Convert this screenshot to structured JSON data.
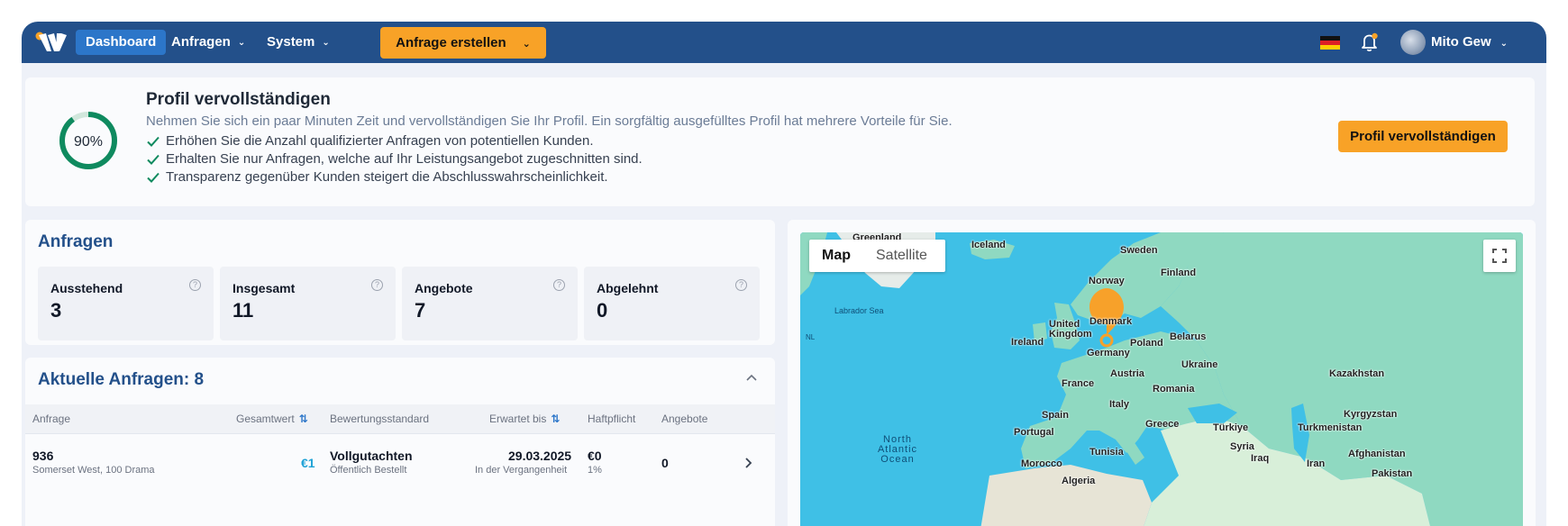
{
  "nav": {
    "dashboard": "Dashboard",
    "anfragen": "Anfragen",
    "system": "System",
    "cta": "Anfrage erstellen",
    "user": "Mito Gew"
  },
  "profile": {
    "percent": "90%",
    "progress": 0.9,
    "title": "Profil vervollständigen",
    "subtitle": "Nehmen Sie sich ein paar Minuten Zeit und vervollständigen Sie Ihr Profil. Ein sorgfältig ausgefülltes Profil hat mehrere Vorteile für Sie.",
    "bullets": [
      "Erhöhen Sie die Anzahl qualifizierter Anfragen von potentiellen Kunden.",
      "Erhalten Sie nur Anfragen, welche auf Ihr Leistungsangebot zugeschnitten sind.",
      "Transparenz gegenüber Kunden steigert die Abschlusswahrscheinlichkeit."
    ],
    "button": "Profil vervollständigen"
  },
  "stats": {
    "title": "Anfragen",
    "items": [
      {
        "label": "Ausstehend",
        "value": "3"
      },
      {
        "label": "Insgesamt",
        "value": "11"
      },
      {
        "label": "Angebote",
        "value": "7"
      },
      {
        "label": "Abgelehnt",
        "value": "0"
      }
    ]
  },
  "table": {
    "title": "Aktuelle Anfragen: 8",
    "headers": {
      "anfrage": "Anfrage",
      "gesamtwert": "Gesamtwert",
      "standard": "Bewertungsstandard",
      "erwartet": "Erwartet bis",
      "haftpflicht": "Haftpflicht",
      "angebote": "Angebote"
    },
    "rows": [
      {
        "id": "936",
        "address": "Somerset West, 100 Drama",
        "value": "€1",
        "standard": "Vollgutachten",
        "standard_sub": "Öffentlich Bestellt",
        "date": "29.03.2025",
        "date_sub": "In der Vergangenheit",
        "liability": "€0",
        "liability_sub": "1%",
        "offers": "0"
      }
    ]
  },
  "map": {
    "map_label": "Map",
    "satellite_label": "Satellite",
    "labels": {
      "greenland": "Greenland",
      "iceland": "Iceland",
      "sweden": "Sweden",
      "finland": "Finland",
      "norway": "Norway",
      "labrador": "Labrador Sea",
      "nl": "NL",
      "uk": "United Kingdom",
      "denmark": "Denmark",
      "ireland": "Ireland",
      "poland": "Poland",
      "belarus": "Belarus",
      "germany": "Germany",
      "ukraine": "Ukraine",
      "austria": "Austria",
      "france": "France",
      "romania": "Romania",
      "kazakhstan": "Kazakhstan",
      "italy": "Italy",
      "spain": "Spain",
      "kyrgyzstan": "Kyrgyzstan",
      "portugal": "Portugal",
      "greece": "Greece",
      "turkiye": "Türkiye",
      "turkmenistan": "Turkmenistan",
      "ocean": "North Atlantic Ocean",
      "syria": "Syria",
      "tunisia": "Tunisia",
      "morocco": "Morocco",
      "iraq": "Iraq",
      "iran": "Iran",
      "afghanistan": "Afghanistan",
      "pakistan": "Pakistan",
      "algeria": "Algeria"
    }
  },
  "colors": {
    "nav": "#23508a",
    "accent": "#f8a227",
    "active_tab": "#2c76c9",
    "progress": "#0f8a5f",
    "map_water": "#3fc0e6",
    "map_land": "#8fd9c1",
    "pin": "#f7a12a"
  }
}
